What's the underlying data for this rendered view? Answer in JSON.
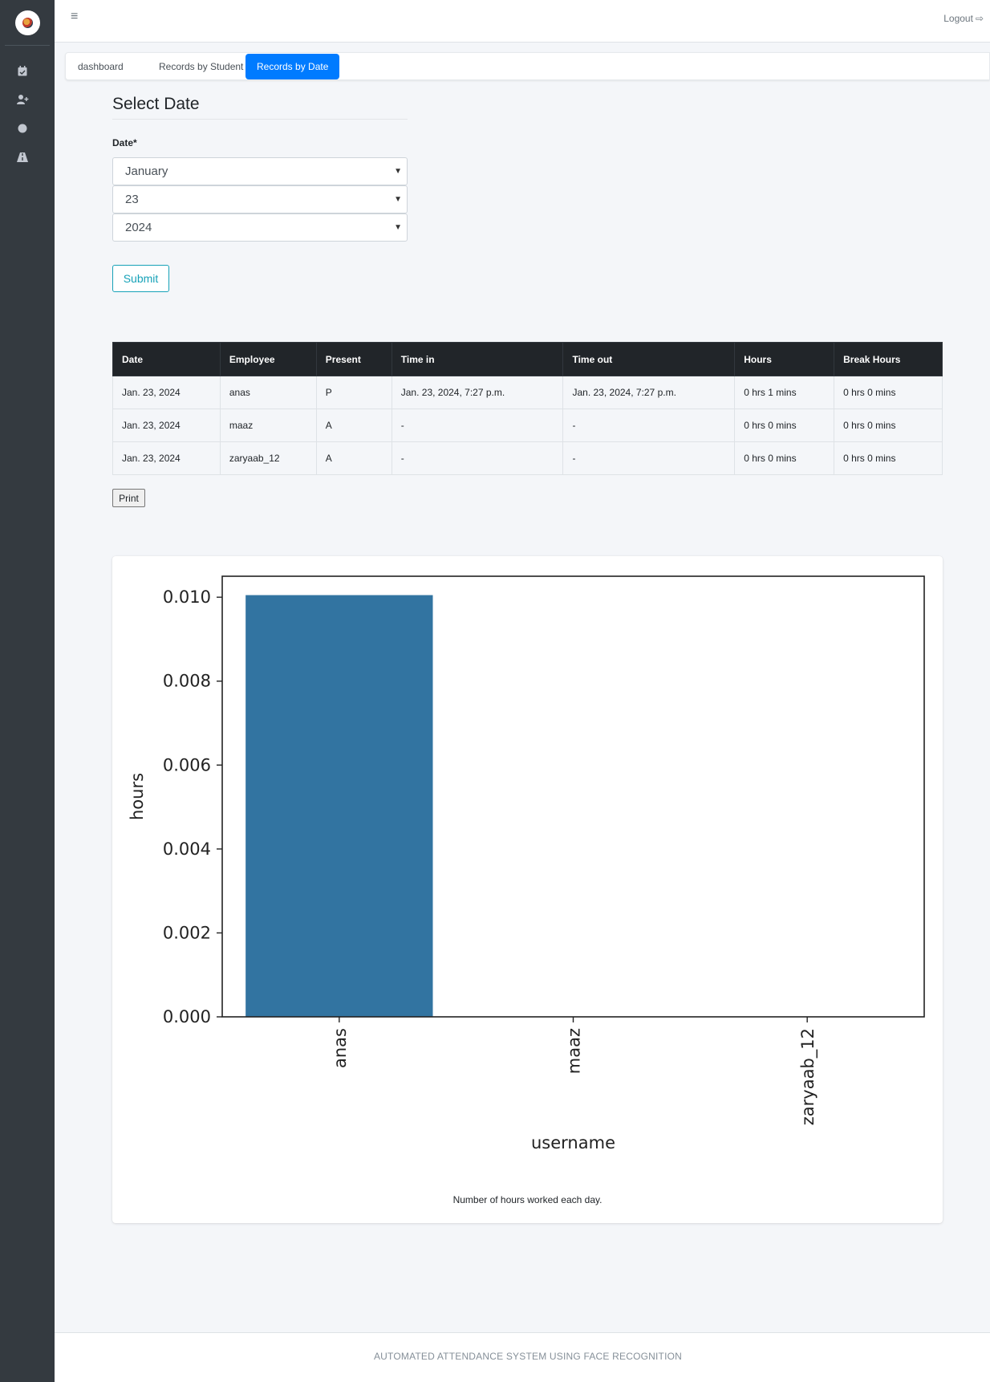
{
  "sidebar": {
    "icons": [
      "logo-icon",
      "calendar-check-icon",
      "user-plus-icon",
      "circle-icon",
      "road-icon"
    ]
  },
  "topbar": {
    "menu_glyph": "≡",
    "logout_label": "Logout",
    "logout_glyph": "⇨"
  },
  "tabs": [
    {
      "label": "dashboard",
      "active": false
    },
    {
      "label": "Records by Student",
      "active": false
    },
    {
      "label": "Records by Date",
      "active": true
    }
  ],
  "form": {
    "title": "Select Date",
    "date_label": "Date*",
    "month": "January",
    "day": "23",
    "year": "2024",
    "submit_label": "Submit"
  },
  "table": {
    "headers": [
      "Date",
      "Employee",
      "Present",
      "Time in",
      "Time out",
      "Hours",
      "Break Hours"
    ],
    "rows": [
      [
        "Jan. 23, 2024",
        "anas",
        "P",
        "Jan. 23, 2024, 7:27 p.m.",
        "Jan. 23, 2024, 7:27 p.m.",
        "0 hrs 1 mins",
        "0 hrs 0 mins"
      ],
      [
        "Jan. 23, 2024",
        "maaz",
        "A",
        "-",
        "-",
        "0 hrs 0 mins",
        "0 hrs 0 mins"
      ],
      [
        "Jan. 23, 2024",
        "zaryaab_12",
        "A",
        "-",
        "-",
        "0 hrs 0 mins",
        "0 hrs 0 mins"
      ]
    ]
  },
  "print_label": "Print",
  "chart_data": {
    "type": "bar",
    "categories": [
      "anas",
      "maaz",
      "zaryaab_12"
    ],
    "values": [
      0.01005,
      0,
      0
    ],
    "title": "",
    "xlabel": "username",
    "ylabel": "hours",
    "ylim": [
      0,
      0.0105
    ],
    "yticks": [
      "0.000",
      "0.002",
      "0.004",
      "0.006",
      "0.008",
      "0.010"
    ],
    "grid": false,
    "bar_color": "#3274a1"
  },
  "chart_caption": "Number of hours worked each day.",
  "footer_text": "AUTOMATED ATTENDANCE SYSTEM USING FACE RECOGNITION",
  "colors": {
    "sidebar": "#343a40",
    "primary": "#007bff",
    "info": "#17a2b8",
    "table_header": "#212529"
  }
}
